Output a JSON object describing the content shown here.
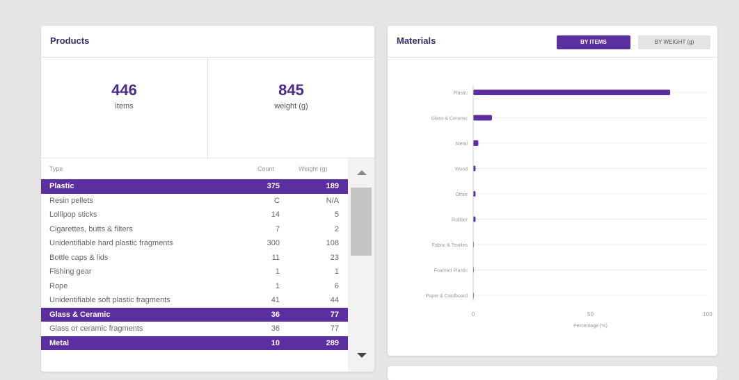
{
  "products": {
    "title": "Products",
    "items_value": "446",
    "items_label": "items",
    "weight_value": "845",
    "weight_label": "weight (g)",
    "columns": {
      "type": "Type",
      "count": "Count",
      "weight": "Weight (g)"
    },
    "rows": [
      {
        "type": "Plastic",
        "count": "375",
        "weight": "189",
        "group": true
      },
      {
        "type": "Resin pellets",
        "count": "C",
        "weight": "N/A",
        "group": false
      },
      {
        "type": "Lollipop sticks",
        "count": "14",
        "weight": "5",
        "group": false
      },
      {
        "type": "Cigarettes, butts & filters",
        "count": "7",
        "weight": "2",
        "group": false
      },
      {
        "type": "Unidentifiable hard plastic fragments",
        "count": "300",
        "weight": "108",
        "group": false
      },
      {
        "type": "Bottle caps & lids",
        "count": "11",
        "weight": "23",
        "group": false
      },
      {
        "type": "Fishing gear",
        "count": "1",
        "weight": "1",
        "group": false
      },
      {
        "type": "Rope",
        "count": "1",
        "weight": "6",
        "group": false
      },
      {
        "type": "Unidentifiable soft plastic fragments",
        "count": "41",
        "weight": "44",
        "group": false
      },
      {
        "type": "Glass & Ceramic",
        "count": "36",
        "weight": "77",
        "group": true
      },
      {
        "type": "Glass or ceramic fragments",
        "count": "36",
        "weight": "77",
        "group": false
      },
      {
        "type": "Metal",
        "count": "10",
        "weight": "289",
        "group": true
      }
    ]
  },
  "materials": {
    "title": "Materials",
    "btn_items": "BY ITEMS",
    "btn_weight": "BY WEIGHT (g)"
  },
  "colors": {
    "accent": "#5b2fa0",
    "title": "#3b2a67"
  },
  "chart_data": {
    "type": "bar",
    "orientation": "horizontal",
    "categories": [
      "Plastic",
      "Glass & Ceramic",
      "Metal",
      "Wood",
      "Other",
      "Rubber",
      "Fabric & Textiles",
      "Foamed Plastic",
      "Paper & Cardboard"
    ],
    "values": [
      84,
      8,
      2.2,
      1,
      1,
      1,
      0,
      0,
      0
    ],
    "xlabel": "Percentage (%)",
    "xlim": [
      0,
      100
    ],
    "xticks": [
      "0",
      "50",
      "100"
    ],
    "grid": true
  }
}
